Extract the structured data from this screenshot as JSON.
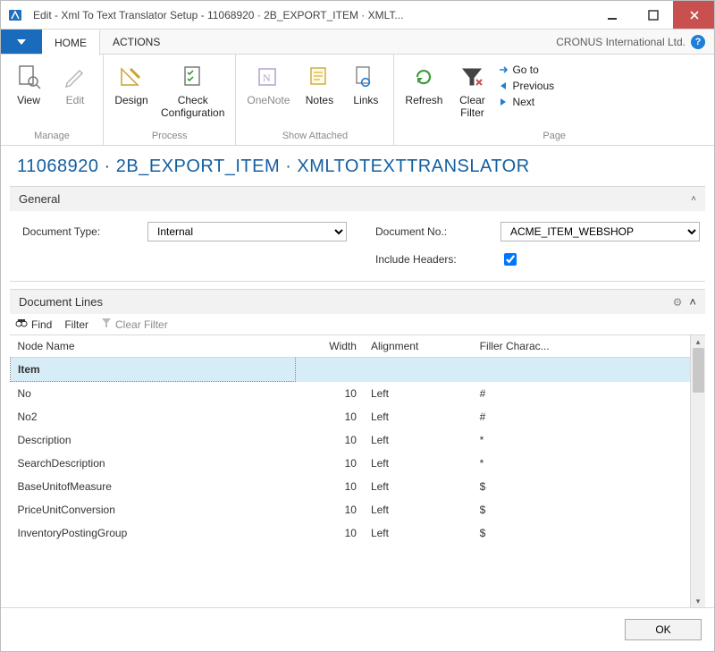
{
  "titlebar": {
    "text": "Edit - Xml To Text Translator Setup - 11068920 · 2B_EXPORT_ITEM · XMLT..."
  },
  "tabs": {
    "home": "HOME",
    "actions": "ACTIONS",
    "company": "CRONUS International Ltd."
  },
  "ribbon": {
    "manage": {
      "label": "Manage",
      "view": "View",
      "edit": "Edit"
    },
    "process": {
      "label": "Process",
      "design": "Design",
      "check": "Check\nConfiguration"
    },
    "show_attached": {
      "label": "Show Attached",
      "onenote": "OneNote",
      "notes": "Notes",
      "links": "Links"
    },
    "page": {
      "label": "Page",
      "refresh": "Refresh",
      "clear_filter": "Clear\nFilter",
      "goto": "Go to",
      "previous": "Previous",
      "next": "Next"
    }
  },
  "heading": "11068920 · 2B_EXPORT_ITEM · XMLTOTEXTTRANSLATOR",
  "general": {
    "title": "General",
    "doc_type_label": "Document Type:",
    "doc_type_value": "Internal",
    "doc_no_label": "Document No.:",
    "doc_no_value": "ACME_ITEM_WEBSHOP",
    "include_headers_label": "Include Headers:",
    "include_headers_value": true
  },
  "lines": {
    "title": "Document Lines",
    "toolbar": {
      "find": "Find",
      "filter": "Filter",
      "clear_filter": "Clear Filter"
    },
    "columns": {
      "node": "Node Name",
      "width": "Width",
      "align": "Alignment",
      "filler": "Filler Charac..."
    },
    "rows": [
      {
        "indent": 1,
        "node": "Item",
        "width": "",
        "align": "",
        "filler": "",
        "selected": true
      },
      {
        "indent": 2,
        "node": "No",
        "width": "10",
        "align": "Left",
        "filler": "#"
      },
      {
        "indent": 2,
        "node": "No2",
        "width": "10",
        "align": "Left",
        "filler": "#"
      },
      {
        "indent": 2,
        "node": "Description",
        "width": "10",
        "align": "Left",
        "filler": "*"
      },
      {
        "indent": 2,
        "node": "SearchDescription",
        "width": "10",
        "align": "Left",
        "filler": "*"
      },
      {
        "indent": 2,
        "node": "BaseUnitofMeasure",
        "width": "10",
        "align": "Left",
        "filler": "$"
      },
      {
        "indent": 2,
        "node": "PriceUnitConversion",
        "width": "10",
        "align": "Left",
        "filler": "$"
      },
      {
        "indent": 2,
        "node": "InventoryPostingGroup",
        "width": "10",
        "align": "Left",
        "filler": "$"
      }
    ]
  },
  "footer": {
    "ok": "OK"
  }
}
